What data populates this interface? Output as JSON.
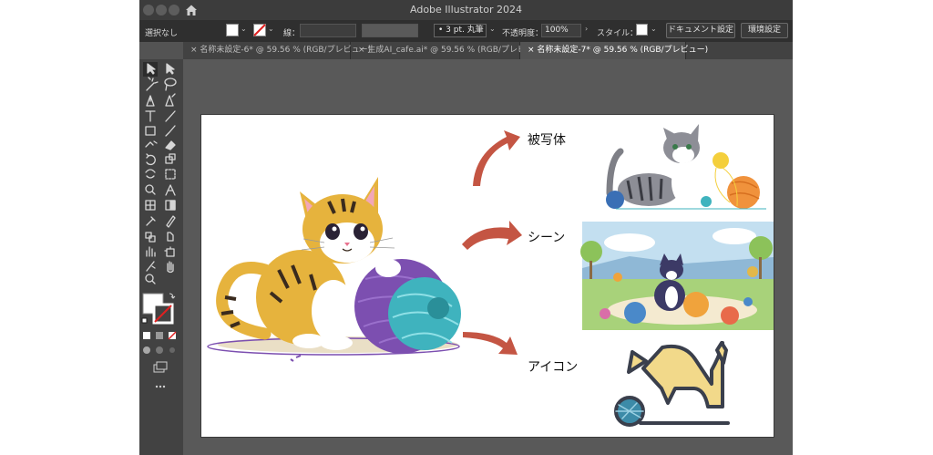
{
  "app": {
    "title": "Adobe Illustrator 2024"
  },
  "control_bar": {
    "selection_label": "選択なし",
    "stroke_label": "線：",
    "brush_label": "3 pt. 丸筆",
    "opacity_label": "不透明度：",
    "opacity_value": "100%",
    "style_label": "スタイル：",
    "document_setup_button": "ドキュメント設定",
    "preferences_button": "環境設定"
  },
  "tabs": [
    {
      "label": "名称未設定-6* @ 59.56 % (RGB/プレビュー)",
      "active": false
    },
    {
      "label": "生成AI_cafe.ai* @ 59.56 % (RGB/プレビュー)",
      "active": false
    },
    {
      "label": "名称未設定-7* @ 59.56 % (RGB/プレビュー)",
      "active": true
    }
  ],
  "artboard": {
    "labels": {
      "subject": "被写体",
      "scene": "シーン",
      "icon": "アイコン"
    }
  },
  "colors": {
    "arrow": "#c45543",
    "yarn_purple": "#7c4fb0",
    "yarn_cyan": "#3fb3be",
    "cat_orange": "#e6b33d",
    "icon_yellow": "#f2d98a",
    "icon_outline": "#3a3f4c"
  }
}
